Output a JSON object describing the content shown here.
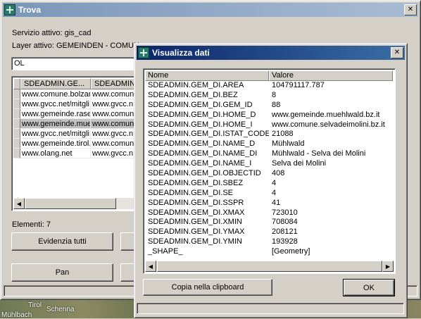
{
  "trova": {
    "title": "Trova",
    "service_label": "Servizio attivo: gis_cad",
    "layer_label": "Layer attivo: GEMEINDEN - COMUN",
    "search_value": "OL",
    "columns": [
      "SDEADMIN.GE...",
      "SDEADMIN.GE..."
    ],
    "rows": [
      [
        "www.comune.bolzar",
        "www.comun"
      ],
      [
        "www.gvcc.net/mitgli",
        "www.gvcc.n"
      ],
      [
        "www.gemeinde.rasei",
        "www.comun"
      ],
      [
        "www.gemeinde.muel",
        "www.comun"
      ],
      [
        "www.gvcc.net/mitgli",
        "www.gvcc.n"
      ],
      [
        "www.gemeinde.tirol.t",
        "www.comun"
      ],
      [
        "www.olang.net",
        "www.gvcc.n"
      ]
    ],
    "selected_row": 3,
    "count_label": "Elementi: 7",
    "highlight_all_label": "Evidenzia tutti",
    "pan_label": "Pan"
  },
  "map": {
    "labels": [
      "Tirol",
      "Schenna",
      "Mühlbach"
    ]
  },
  "dati": {
    "title": "Visualizza dati",
    "col_name": "Nome",
    "col_value": "Valore",
    "rows": [
      {
        "name": "SDEADMIN.GEM_DI.AREA",
        "value": "104791117.787"
      },
      {
        "name": "SDEADMIN.GEM_DI.BEZ",
        "value": "8"
      },
      {
        "name": "SDEADMIN.GEM_DI.GEM_ID",
        "value": "88"
      },
      {
        "name": "SDEADMIN.GEM_DI.HOME_D",
        "value": "www.gemeinde.muehlwald.bz.it"
      },
      {
        "name": "SDEADMIN.GEM_DI.HOME_I",
        "value": "www.comune.selvadeimolini.bz.it"
      },
      {
        "name": "SDEADMIN.GEM_DI.ISTAT_CODE",
        "value": "21088"
      },
      {
        "name": "SDEADMIN.GEM_DI.NAME_D",
        "value": "Mühlwald"
      },
      {
        "name": "SDEADMIN.GEM_DI.NAME_DI",
        "value": "Mühlwald - Selva dei Molini"
      },
      {
        "name": "SDEADMIN.GEM_DI.NAME_I",
        "value": "Selva dei Molini"
      },
      {
        "name": "SDEADMIN.GEM_DI.OBJECTID",
        "value": "408"
      },
      {
        "name": "SDEADMIN.GEM_DI.SBEZ",
        "value": "4"
      },
      {
        "name": "SDEADMIN.GEM_DI.SE",
        "value": "4"
      },
      {
        "name": "SDEADMIN.GEM_DI.SSPR",
        "value": "41"
      },
      {
        "name": "SDEADMIN.GEM_DI.XMAX",
        "value": "723010"
      },
      {
        "name": "SDEADMIN.GEM_DI.XMIN",
        "value": "708084"
      },
      {
        "name": "SDEADMIN.GEM_DI.YMAX",
        "value": "208121"
      },
      {
        "name": "SDEADMIN.GEM_DI.YMIN",
        "value": "193928"
      },
      {
        "name": "_SHAPE_",
        "value": "[Geometry]"
      }
    ],
    "copy_label": "Copia nella clipboard",
    "ok_label": "OK"
  }
}
